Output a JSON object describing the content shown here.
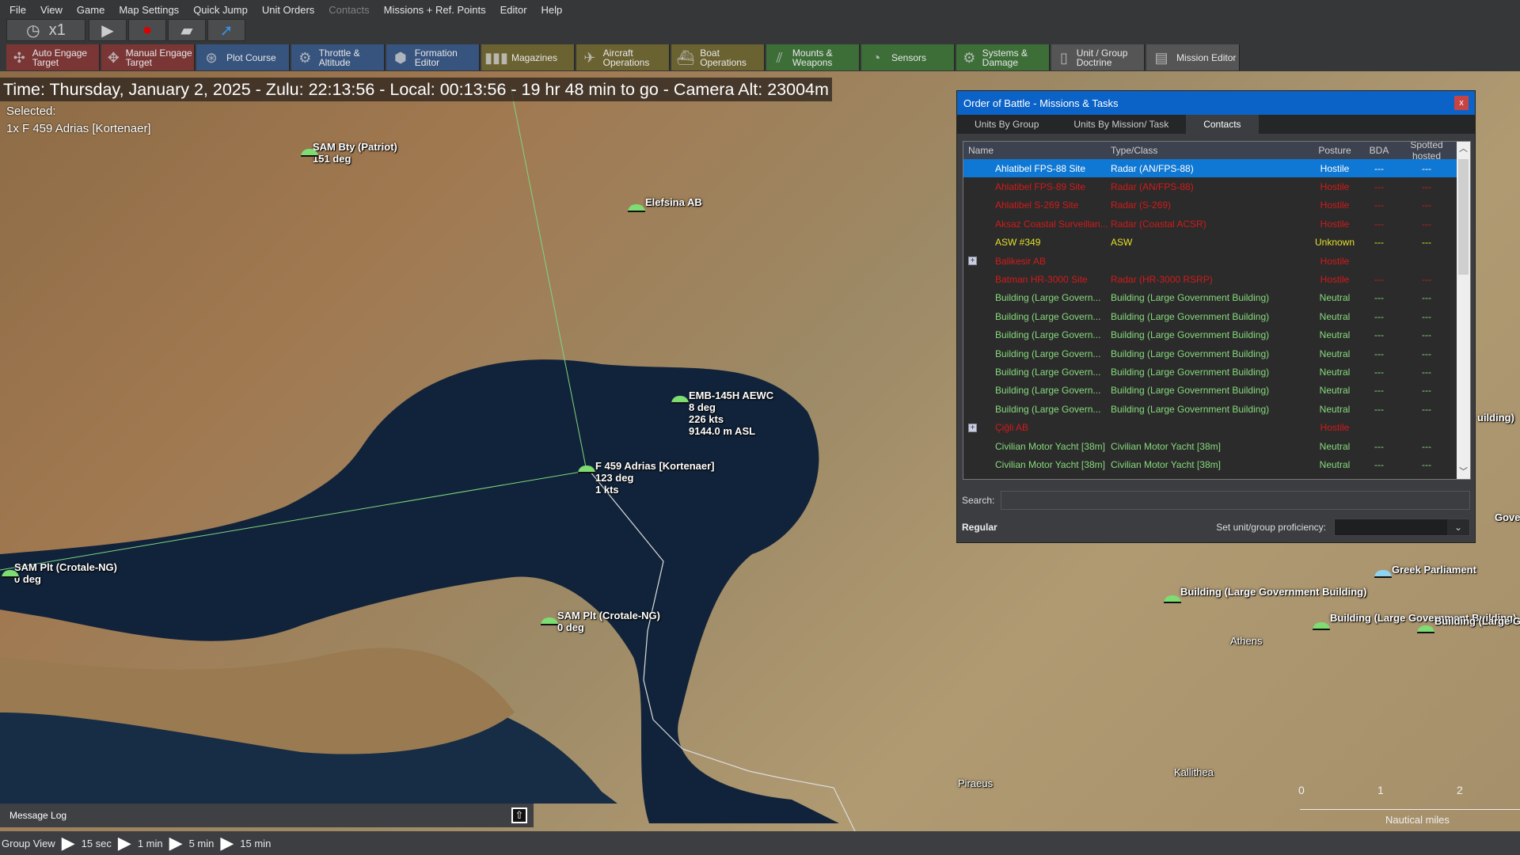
{
  "menu": [
    "File",
    "View",
    "Game",
    "Map Settings",
    "Quick Jump",
    "Unit Orders",
    "Contacts",
    "Missions + Ref. Points",
    "Editor",
    "Help"
  ],
  "time_controls": {
    "speed": "x1",
    "icons": [
      "clock-icon",
      "play-icon",
      "record-icon",
      "stack-icon",
      "jump-arrow-icon"
    ]
  },
  "toolbar": [
    {
      "label": "Auto Engage Target",
      "icon": "auto-engage-icon",
      "color": "#7a3535"
    },
    {
      "label": "Manual Engage Target",
      "icon": "manual-engage-icon",
      "color": "#7a3535"
    },
    {
      "label": "Plot Course",
      "icon": "plot-course-icon",
      "color": "#37547e"
    },
    {
      "label": "Throttle & Altitude",
      "icon": "throttle-icon",
      "color": "#37547e"
    },
    {
      "label": "Formation Editor",
      "icon": "formation-icon",
      "color": "#37547e"
    },
    {
      "label": "Magazines",
      "icon": "magazines-icon",
      "color": "#6b6232"
    },
    {
      "label": "Aircraft Operations",
      "icon": "aircraft-icon",
      "color": "#6b6232"
    },
    {
      "label": "Boat Operations",
      "icon": "boat-icon",
      "color": "#6b6232"
    },
    {
      "label": "Mounts & Weapons",
      "icon": "weapons-icon",
      "color": "#3d6e38"
    },
    {
      "label": "Sensors",
      "icon": "sensors-icon",
      "color": "#3d6e38"
    },
    {
      "label": "Systems & Damage",
      "icon": "gear-icon",
      "color": "#3d6e38"
    },
    {
      "label": "Unit / Group Doctrine",
      "icon": "doctrine-icon",
      "color": "#555555"
    },
    {
      "label": "Mission Editor",
      "icon": "mission-editor-icon",
      "color": "#555555"
    }
  ],
  "status_line": "Time: Thursday, January 2, 2025 - Zulu: 22:13:56 - Local: 00:13:56 - 19 hr 48 min to go -  Camera Alt: 23004m",
  "selected": {
    "label": "Selected:",
    "unit": "1x F 459 Adrias [Kortenaer]"
  },
  "map_labels": [
    {
      "text": "SAM Bty (Patriot)\n151 deg"
    },
    {
      "text": "Elefsina AB"
    },
    {
      "text": "EMB-145H AEWC\n8 deg\n226 kts\n9144.0 m ASL"
    },
    {
      "text": "F 459 Adrias [Kortenaer]\n123 deg\n1 kts"
    },
    {
      "text": "SAM Plt (Crotale-NG)\n0 deg"
    },
    {
      "text": "SAM Plt (Crotale-NG)\n0 deg"
    },
    {
      "text": "Greek Parliament"
    },
    {
      "text": "Building (Large Government Building)"
    },
    {
      "text": "Building (Large Government Building)"
    },
    {
      "text": "Building (Large Go"
    },
    {
      "text": "uilding)"
    },
    {
      "text": "Governi"
    }
  ],
  "place_names": [
    "Athens",
    "Piraeus",
    "Kallithea"
  ],
  "scale_bar": {
    "ticks": [
      "0",
      "1",
      "2"
    ],
    "unit": "Nautical miles"
  },
  "dialog": {
    "title": "Order of Battle - Missions & Tasks",
    "close": "x",
    "tabs": [
      "Units By Group",
      "Units By Mission/ Task",
      "Contacts"
    ],
    "active_tab": "Contacts",
    "columns": [
      "Name",
      "Type/Class",
      "Posture",
      "BDA",
      "Spotted hosted"
    ],
    "rows": [
      {
        "name": "Ahlatibel FPS-88 Site",
        "type": "Radar (AN/FPS-88)",
        "posture": "Hostile",
        "bda": "---",
        "spotted": "---",
        "selected": true
      },
      {
        "name": "Ahlatibel FPS-89 Site",
        "type": "Radar (AN/FPS-88)",
        "posture": "Hostile",
        "bda": "---",
        "spotted": "---"
      },
      {
        "name": "Ahlatibel S-269 Site",
        "type": "Radar (S-269)",
        "posture": "Hostile",
        "bda": "---",
        "spotted": "---"
      },
      {
        "name": "Aksaz Coastal Surveillan...",
        "type": "Radar (Coastal ACSR)",
        "posture": "Hostile",
        "bda": "---",
        "spotted": "---"
      },
      {
        "name": "ASW #349",
        "type": "ASW",
        "posture": "Unknown",
        "bda": "---",
        "spotted": "---"
      },
      {
        "name": "Balikesir AB",
        "type": "",
        "posture": "Hostile",
        "bda": "",
        "spotted": "",
        "expand": true
      },
      {
        "name": "Batman HR-3000 Site",
        "type": "Radar (HR-3000 RSRP)",
        "posture": "Hostile",
        "bda": "---",
        "spotted": "---"
      },
      {
        "name": "Building (Large Govern...",
        "type": "Building (Large Government Building)",
        "posture": "Neutral",
        "bda": "---",
        "spotted": "---"
      },
      {
        "name": "Building (Large Govern...",
        "type": "Building (Large Government Building)",
        "posture": "Neutral",
        "bda": "---",
        "spotted": "---"
      },
      {
        "name": "Building (Large Govern...",
        "type": "Building (Large Government Building)",
        "posture": "Neutral",
        "bda": "---",
        "spotted": "---"
      },
      {
        "name": "Building (Large Govern...",
        "type": "Building (Large Government Building)",
        "posture": "Neutral",
        "bda": "---",
        "spotted": "---"
      },
      {
        "name": "Building (Large Govern...",
        "type": "Building (Large Government Building)",
        "posture": "Neutral",
        "bda": "---",
        "spotted": "---"
      },
      {
        "name": "Building (Large Govern...",
        "type": "Building (Large Government Building)",
        "posture": "Neutral",
        "bda": "---",
        "spotted": "---"
      },
      {
        "name": "Building (Large Govern...",
        "type": "Building (Large Government Building)",
        "posture": "Neutral",
        "bda": "---",
        "spotted": "---"
      },
      {
        "name": "Çiğli AB",
        "type": "",
        "posture": "Hostile",
        "bda": "",
        "spotted": "",
        "expand": true
      },
      {
        "name": "Civilian Motor Yacht [38m]",
        "type": "Civilian Motor Yacht [38m]",
        "posture": "Neutral",
        "bda": "---",
        "spotted": "---"
      },
      {
        "name": "Civilian Motor Yacht [38m]",
        "type": "Civilian Motor Yacht [38m]",
        "posture": "Neutral",
        "bda": "---",
        "spotted": "---"
      }
    ],
    "search_label": "Search:",
    "search_value": "",
    "proficiency_current": "Regular",
    "proficiency_label": "Set unit/group proficiency:",
    "posture_colors": {
      "Hostile": "#d21a1a",
      "Neutral": "#86d97c",
      "Unknown": "#e3e02a"
    }
  },
  "message_log": "Message Log",
  "statusbar": {
    "group_view": "Group View",
    "steps": [
      "15 sec",
      "1 min",
      "5 min",
      "15 min"
    ]
  }
}
